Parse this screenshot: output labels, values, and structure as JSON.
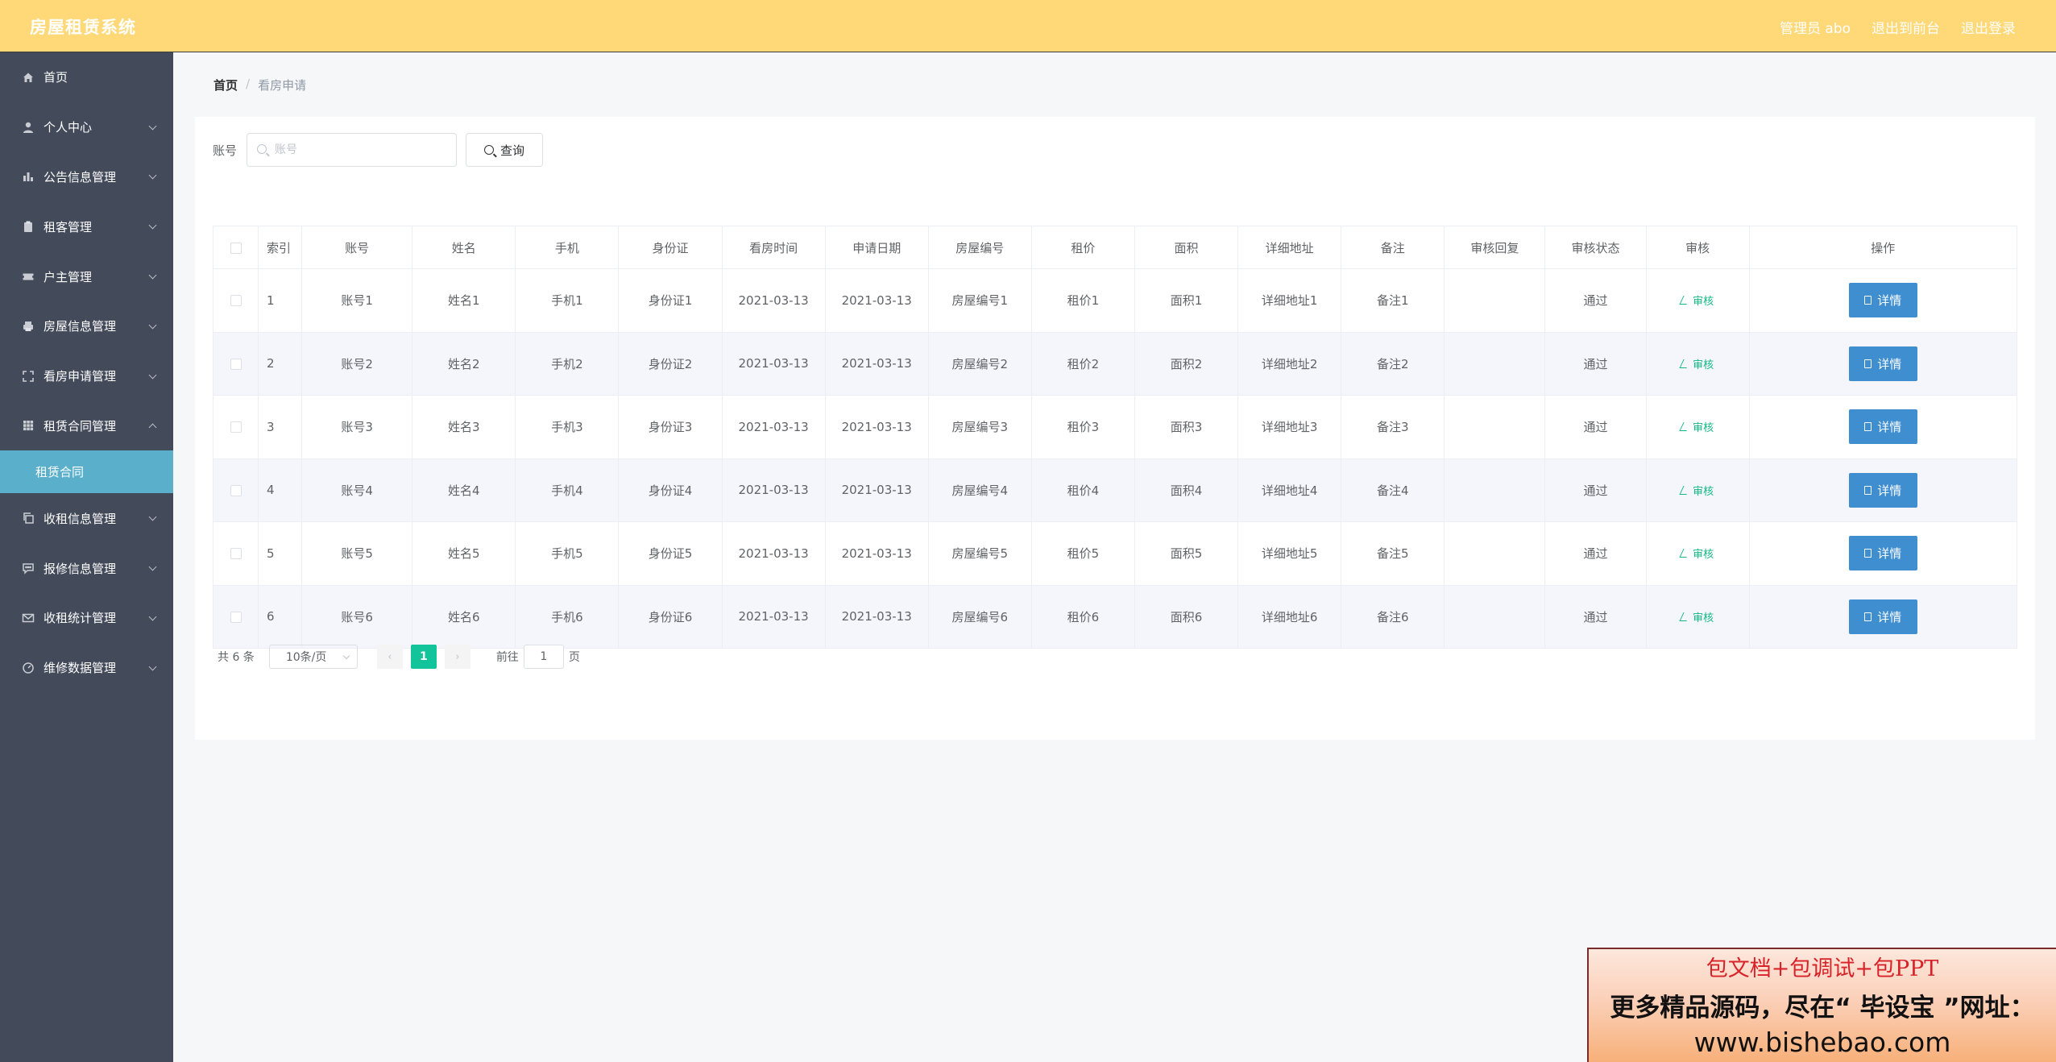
{
  "header": {
    "title": "房屋租赁系统",
    "user": "管理员 abo",
    "back_to_front": "退出到前台",
    "logout": "退出登录"
  },
  "sidebar": {
    "items": [
      {
        "label": "首页",
        "icon": "home-icon",
        "has_children": false
      },
      {
        "label": "个人中心",
        "icon": "user-icon",
        "has_children": true
      },
      {
        "label": "公告信息管理",
        "icon": "bar-chart-icon",
        "has_children": true
      },
      {
        "label": "租客管理",
        "icon": "clipboard-icon",
        "has_children": true
      },
      {
        "label": "户主管理",
        "icon": "ticket-icon",
        "has_children": true
      },
      {
        "label": "房屋信息管理",
        "icon": "printer-icon",
        "has_children": true
      },
      {
        "label": "看房申请管理",
        "icon": "fullscreen-icon",
        "has_children": true
      },
      {
        "label": "租赁合同管理",
        "icon": "grid-icon",
        "has_children": true,
        "expanded": true
      },
      {
        "label": "收租信息管理",
        "icon": "copy-icon",
        "has_children": true
      },
      {
        "label": "报修信息管理",
        "icon": "chat-icon",
        "has_children": true
      },
      {
        "label": "收租统计管理",
        "icon": "mail-icon",
        "has_children": true
      },
      {
        "label": "维修数据管理",
        "icon": "odometer-icon",
        "has_children": true
      }
    ],
    "submenu_active": "租赁合同"
  },
  "breadcrumb": {
    "home": "首页",
    "separator": "/",
    "current": "看房申请"
  },
  "search": {
    "label": "账号",
    "placeholder": "账号",
    "button": "查询"
  },
  "table": {
    "columns": [
      "索引",
      "账号",
      "姓名",
      "手机",
      "身份证",
      "看房时间",
      "申请日期",
      "房屋编号",
      "租价",
      "面积",
      "详细地址",
      "备注",
      "审核回复",
      "审核状态",
      "审核",
      "操作"
    ],
    "audit_link": "审核",
    "detail_button": "详情",
    "rows": [
      {
        "index": "1",
        "account": "账号1",
        "name": "姓名1",
        "phone": "手机1",
        "id_card": "身份证1",
        "view_time": "2021-03-13",
        "apply_date": "2021-03-13",
        "house_no": "房屋编号1",
        "rent": "租价1",
        "area": "面积1",
        "address": "详细地址1",
        "note": "备注1",
        "reply": "",
        "status": "通过"
      },
      {
        "index": "2",
        "account": "账号2",
        "name": "姓名2",
        "phone": "手机2",
        "id_card": "身份证2",
        "view_time": "2021-03-13",
        "apply_date": "2021-03-13",
        "house_no": "房屋编号2",
        "rent": "租价2",
        "area": "面积2",
        "address": "详细地址2",
        "note": "备注2",
        "reply": "",
        "status": "通过"
      },
      {
        "index": "3",
        "account": "账号3",
        "name": "姓名3",
        "phone": "手机3",
        "id_card": "身份证3",
        "view_time": "2021-03-13",
        "apply_date": "2021-03-13",
        "house_no": "房屋编号3",
        "rent": "租价3",
        "area": "面积3",
        "address": "详细地址3",
        "note": "备注3",
        "reply": "",
        "status": "通过"
      },
      {
        "index": "4",
        "account": "账号4",
        "name": "姓名4",
        "phone": "手机4",
        "id_card": "身份证4",
        "view_time": "2021-03-13",
        "apply_date": "2021-03-13",
        "house_no": "房屋编号4",
        "rent": "租价4",
        "area": "面积4",
        "address": "详细地址4",
        "note": "备注4",
        "reply": "",
        "status": "通过"
      },
      {
        "index": "5",
        "account": "账号5",
        "name": "姓名5",
        "phone": "手机5",
        "id_card": "身份证5",
        "view_time": "2021-03-13",
        "apply_date": "2021-03-13",
        "house_no": "房屋编号5",
        "rent": "租价5",
        "area": "面积5",
        "address": "详细地址5",
        "note": "备注5",
        "reply": "",
        "status": "通过"
      },
      {
        "index": "6",
        "account": "账号6",
        "name": "姓名6",
        "phone": "手机6",
        "id_card": "身份证6",
        "view_time": "2021-03-13",
        "apply_date": "2021-03-13",
        "house_no": "房屋编号6",
        "rent": "租价6",
        "area": "面积6",
        "address": "详细地址6",
        "note": "备注6",
        "reply": "",
        "status": "通过"
      }
    ]
  },
  "pagination": {
    "total": "共 6 条",
    "page_size": "10条/页",
    "current_page": "1",
    "goto_label": "前往",
    "goto_value": "1",
    "goto_suffix": "页"
  },
  "promo": {
    "line1": "包文档+包调试+包PPT",
    "line2": "更多精品源码，尽在“ 毕设宝 ”网址：",
    "line3": "www.bishebao.com"
  },
  "colors": {
    "header_bg": "#ffd877",
    "sidebar_bg": "#434a5a",
    "submenu_active_bg": "#5ab0cb",
    "detail_button_bg": "#3e8ed0",
    "audit_link": "#13b786",
    "pager_active": "#13c39a"
  }
}
